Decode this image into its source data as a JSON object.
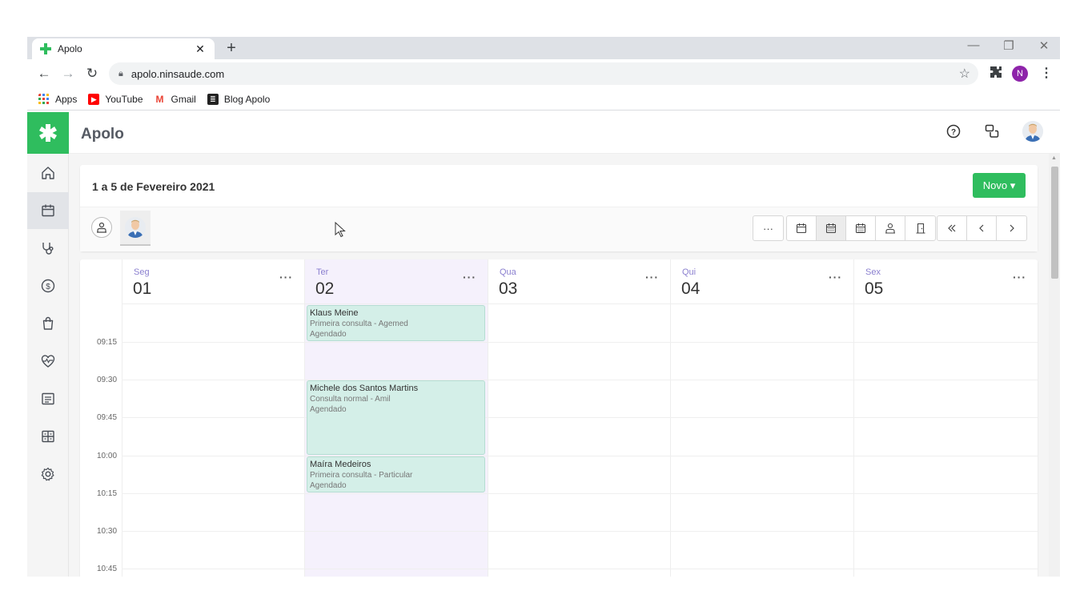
{
  "browser": {
    "tab_title": "Apolo",
    "url": "apolo.ninsaude.com",
    "profile_initial": "N",
    "bookmarks": [
      "Apps",
      "YouTube",
      "Gmail",
      "Blog Apolo"
    ]
  },
  "app": {
    "title": "Apolo",
    "accent_color": "#2fbd5e",
    "today_color": "#f5f1fc",
    "event_color": "#d4efe8"
  },
  "header": {
    "range_title": "1 a 5 de Fevereiro 2021",
    "new_button": "Novo ▾",
    "more_label": "···"
  },
  "sidebar": {
    "items": [
      {
        "icon": "home-icon"
      },
      {
        "icon": "calendar-icon",
        "active": true
      },
      {
        "icon": "stethoscope-icon"
      },
      {
        "icon": "dollar-icon"
      },
      {
        "icon": "shopping-bag-icon"
      },
      {
        "icon": "heart-pulse-icon"
      },
      {
        "icon": "report-icon"
      },
      {
        "icon": "grid-icon"
      },
      {
        "icon": "gear-icon"
      }
    ]
  },
  "calendar": {
    "days": [
      {
        "name": "Seg",
        "num": "01",
        "more": "···"
      },
      {
        "name": "Ter",
        "num": "02",
        "more": "···"
      },
      {
        "name": "Qua",
        "num": "03",
        "more": "···"
      },
      {
        "name": "Qui",
        "num": "04",
        "more": "···"
      },
      {
        "name": "Sex",
        "num": "05",
        "more": "···"
      }
    ],
    "times": [
      "09:15",
      "09:30",
      "09:45",
      "10:00",
      "10:15",
      "10:30",
      "10:45"
    ],
    "events": [
      {
        "name": "Klaus Meine",
        "type": "Primeira consulta - Agemed",
        "status": "Agendado"
      },
      {
        "name": "Michele dos Santos Martins",
        "type": "Consulta normal - Amil",
        "status": "Agendado"
      },
      {
        "name": "Maíra Medeiros",
        "type": "Primeira consulta - Particular",
        "status": "Agendado"
      }
    ]
  }
}
